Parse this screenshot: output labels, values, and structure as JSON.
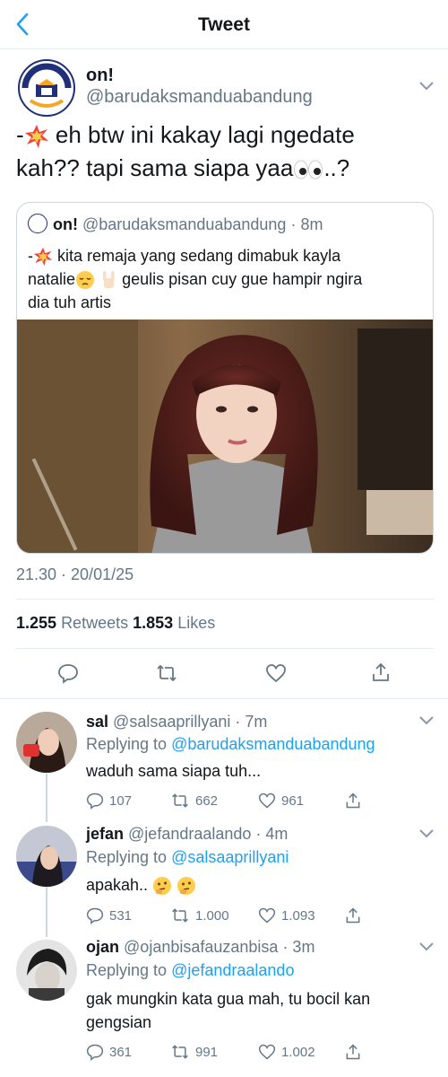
{
  "header": {
    "title": "Tweet",
    "back_icon": "chevron-left-icon",
    "accent": "#1da1f2"
  },
  "tweet": {
    "author_name": "on!",
    "author_handle": "@barudaksmanduabandung",
    "avatar_text": "SMAN DUA BANDUNG",
    "text_prefix": "-",
    "text_line1": " eh btw ini kakay lagi ngedate",
    "text_line2": "kah?? tapi sama siapa yaa",
    "text_suffix": "..?",
    "timestamp": "21.30 · 20/01/25",
    "retweets": "1.255",
    "retweets_label": "Retweets",
    "likes": "1.853",
    "likes_label": "Likes"
  },
  "quote": {
    "name": "on!",
    "handle": "@barudaksmanduabandung",
    "time": "· 8m",
    "text_prefix": "-",
    "text_1": " kita remaja yang sedang dimabuk kayla",
    "text_2": "natalie",
    "text_3": " geulis pisan cuy gue hampir ngira",
    "text_4": "dia tuh artis"
  },
  "replies": [
    {
      "name": "sal",
      "handle": "@salsaaprillyani",
      "time": "· 7m",
      "replying_prefix": "Replying to",
      "replying_to": "@barudaksmanduabandung",
      "text": "waduh sama siapa tuh...",
      "comments": "107",
      "retweets": "662",
      "likes": "961"
    },
    {
      "name": "jefan",
      "handle": "@jefandraalando",
      "time": "· 4m",
      "replying_prefix": "Replying to",
      "replying_to": "@salsaaprillyani",
      "text": "apakah..",
      "comments": "531",
      "retweets": "1.000",
      "likes": "1.093"
    },
    {
      "name": "ojan",
      "handle": "@ojanbisafauzanbisa",
      "time": "· 3m",
      "replying_prefix": "Replying to",
      "replying_to": "@jefandraalando",
      "text": "gak mungkin kata gua mah, tu bocil kan gengsian",
      "comments": "361",
      "retweets": "991",
      "likes": "1.002"
    }
  ]
}
